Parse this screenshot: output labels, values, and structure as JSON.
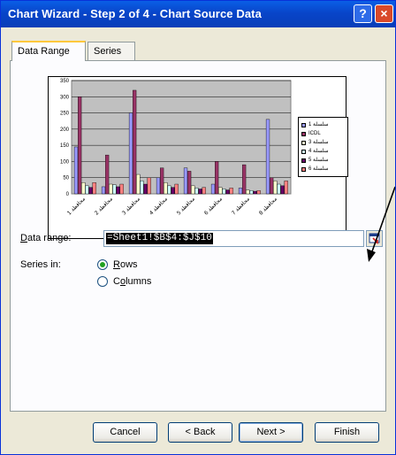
{
  "window": {
    "title": "Chart Wizard - Step 2 of 4 - Chart Source Data",
    "help_glyph": "?",
    "close_glyph": "×"
  },
  "tabs": [
    {
      "label": "Data Range",
      "active": true
    },
    {
      "label": "Series",
      "active": false
    }
  ],
  "preview_chart": {
    "y_ticks": [
      "0",
      "50",
      "100",
      "150",
      "200",
      "250",
      "300",
      "350"
    ],
    "category_labels": [
      "محافظة 1",
      "محافظة 2",
      "محافظة 3",
      "محافظة 4",
      "محافظة 5",
      "محافظة 6",
      "محافظة 7",
      "محافظة 8"
    ],
    "legend": [
      "سلسلة 1",
      "ICDL",
      "سلسلة 3",
      "سلسلة 4",
      "سلسلة 5",
      "سلسلة 6"
    ]
  },
  "chart_data": {
    "type": "bar",
    "ylim": [
      0,
      350
    ],
    "categories": [
      "محافظة 1",
      "محافظة 2",
      "محافظة 3",
      "محافظة 4",
      "محافظة 5",
      "محافظة 6",
      "محافظة 7",
      "محافظة 8"
    ],
    "series": [
      {
        "name": "سلسلة 1",
        "color": "#9999FF",
        "values": [
          145,
          22,
          250,
          50,
          80,
          30,
          18,
          230
        ]
      },
      {
        "name": "ICDL",
        "color": "#993366",
        "values": [
          300,
          120,
          320,
          80,
          70,
          100,
          90,
          50
        ]
      },
      {
        "name": "سلسلة 3",
        "color": "#FFFFCC",
        "values": [
          35,
          30,
          60,
          35,
          25,
          20,
          12,
          40
        ]
      },
      {
        "name": "سلسلة 4",
        "color": "#CCFFFF",
        "values": [
          25,
          28,
          40,
          25,
          18,
          15,
          10,
          30
        ]
      },
      {
        "name": "سلسلة 5",
        "color": "#660066",
        "values": [
          20,
          22,
          30,
          20,
          15,
          12,
          8,
          25
        ]
      },
      {
        "name": "سلسلة 6",
        "color": "#FF8080",
        "values": [
          35,
          30,
          50,
          30,
          20,
          18,
          10,
          40
        ]
      }
    ]
  },
  "data_range": {
    "label": "Data range:",
    "value": "=Sheet1!$B$4:$J$10"
  },
  "series_in": {
    "label": "Series in:",
    "options": [
      {
        "label": "Rows",
        "checked": true
      },
      {
        "label": "Columns",
        "checked": false
      }
    ]
  },
  "buttons": {
    "cancel": "Cancel",
    "back": "< Back",
    "next": "Next >",
    "finish": "Finish"
  },
  "colors": {
    "title_bar": "#0845C9",
    "plot_bg": "#C0C0C0",
    "dialog_bg": "#ECE9D8"
  }
}
